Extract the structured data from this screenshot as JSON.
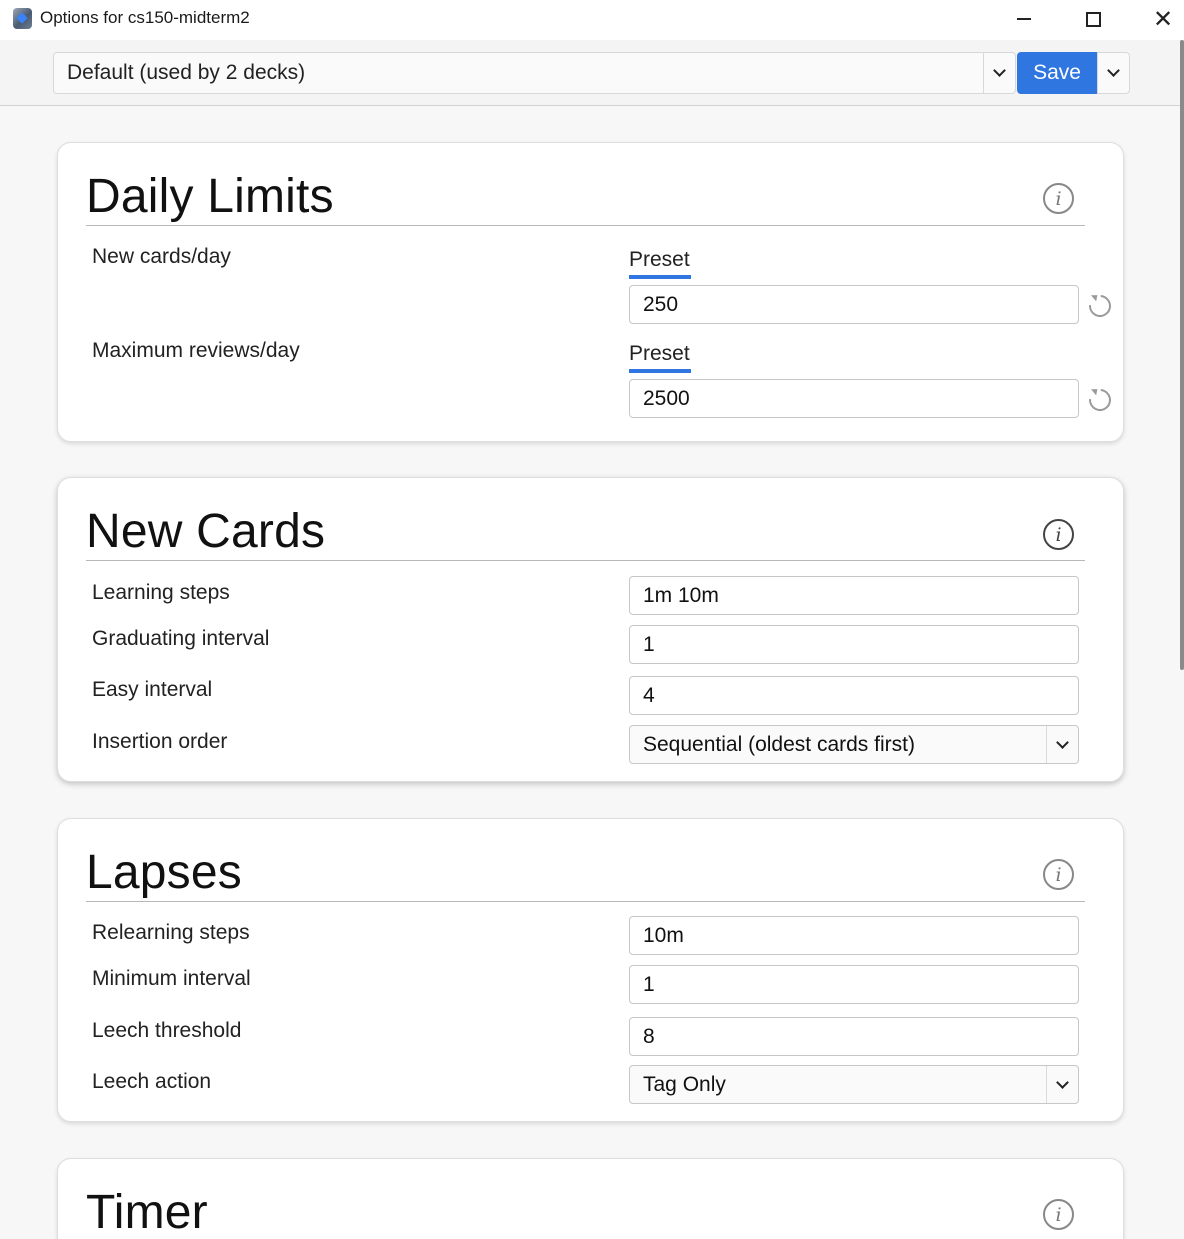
{
  "window": {
    "title": "Options for cs150-midterm2",
    "icon": "anki-app-icon",
    "close_glyph": "✕"
  },
  "toolbar": {
    "preset_value": "Default (used by 2 decks)",
    "save_label": "Save"
  },
  "sections": {
    "daily_limits": {
      "title": "Daily Limits",
      "info_glyph": "i",
      "rows": [
        {
          "label": "New cards/day",
          "tab": "Preset",
          "value": "250"
        },
        {
          "label": "Maximum reviews/day",
          "tab": "Preset",
          "value": "2500"
        }
      ]
    },
    "new_cards": {
      "title": "New Cards",
      "info_glyph": "i",
      "rows": [
        {
          "label": "Learning steps",
          "value": "1m 10m"
        },
        {
          "label": "Graduating interval",
          "value": "1"
        },
        {
          "label": "Easy interval",
          "value": "4"
        },
        {
          "label": "Insertion order",
          "value": "Sequential (oldest cards first)"
        }
      ]
    },
    "lapses": {
      "title": "Lapses",
      "info_glyph": "i",
      "rows": [
        {
          "label": "Relearning steps",
          "value": "10m"
        },
        {
          "label": "Minimum interval",
          "value": "1"
        },
        {
          "label": "Leech threshold",
          "value": "8"
        },
        {
          "label": "Leech action",
          "value": "Tag Only"
        }
      ]
    },
    "timer": {
      "title": "Timer",
      "info_glyph": "i"
    }
  },
  "colors": {
    "accent": "#2f76e0",
    "background": "#f7f7f7",
    "card": "#ffffff"
  }
}
